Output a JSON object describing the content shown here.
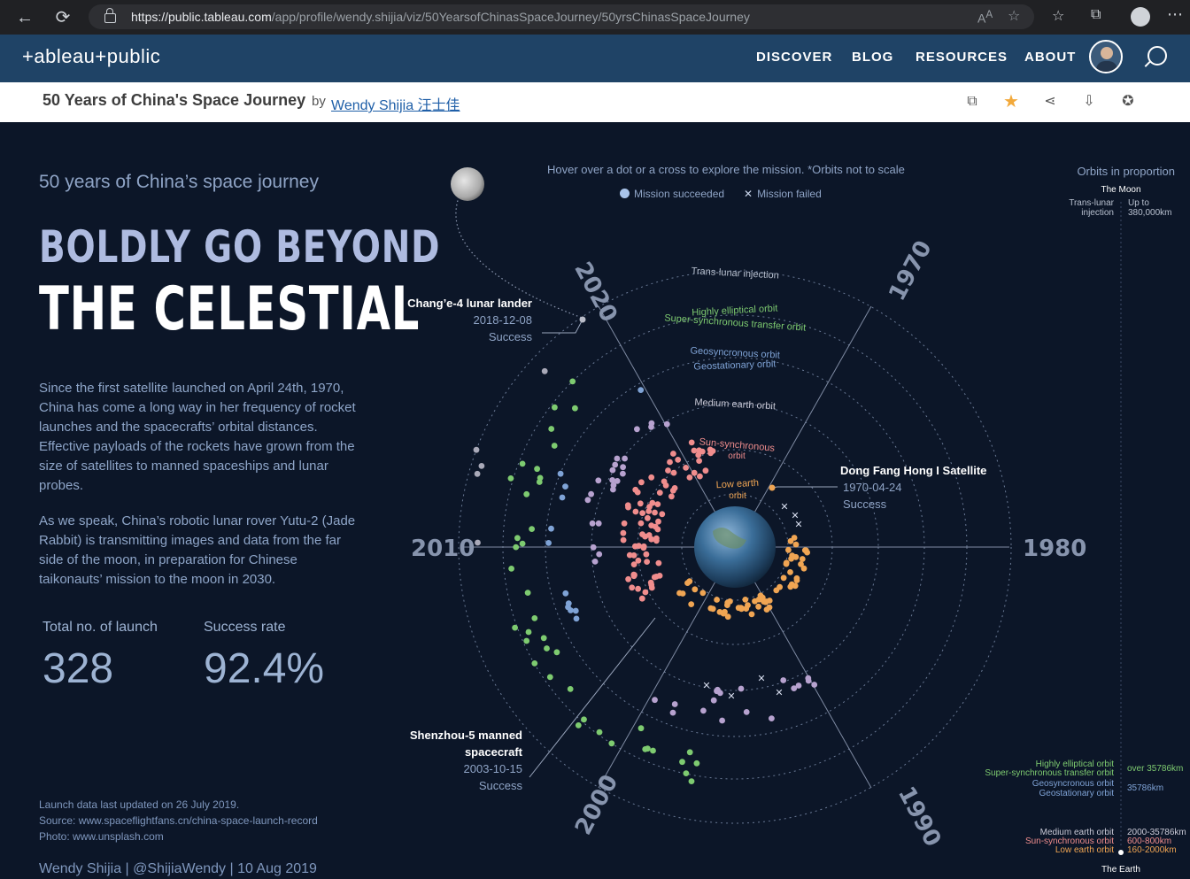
{
  "browser": {
    "url_domain": "https://public.tableau.com",
    "url_path": "/app/profile/wendy.shijia/viz/50YearsofChinasSpaceJourney/50yrsChinasSpaceJourney"
  },
  "header": {
    "logo": "+ableau+public",
    "nav": [
      "DISCOVER",
      "BLOG",
      "RESOURCES",
      "ABOUT"
    ]
  },
  "titlebar": {
    "title": "50 Years of China's Space Journey",
    "by": "by",
    "author": "Wendy Shijia 汪士佳"
  },
  "left": {
    "subtitle": "50 years of China’s space journey",
    "headline1": "BOLDLY GO BEYOND",
    "headline2": "THE CELESTIAL",
    "para1": "Since the first satellite launched on April 24th, 1970, China has come a long way in her frequency of rocket launches and the spacecrafts’ orbital distances. Effective payloads of the rockets have grown from the size of satellites to manned spaceships and lunar probes.",
    "para2": "As we speak, China’s robotic lunar rover Yutu-2 (Jade Rabbit) is transmitting images and data from the far side of the moon, in preparation for Chinese taikonauts’ mission to the moon in 2030.",
    "kpi_launch_label": "Total no. of launch",
    "kpi_launch_value": "328",
    "kpi_rate_label": "Success rate",
    "kpi_rate_value": "92.4%",
    "updated": "Launch data last updated on 26 July 2019.",
    "source": "Source:  www.spaceflightfans.cn/china-space-launch-record",
    "photo": "Photo: www.unsplash.com",
    "byline": "Wendy Shijia  | @ShijiaWendy | 10 Aug 2019"
  },
  "viz": {
    "hover_hint": "Hover over a dot or a cross to explore the mission. *Orbits not to scale",
    "legend_success": "Mission succeeded",
    "legend_failed": "Mission failed",
    "years": [
      "2020",
      "1970",
      "2010",
      "1980",
      "2000",
      "1990"
    ],
    "orbits": [
      "Trans-lunar injection",
      "Highly elliptical orbit",
      "Super-synchronous transfer orbit",
      "Geosyncronous orbit",
      "Geostationary orbit",
      "Medium earth orbit",
      "Sun-synchronous",
      "orbit",
      "Low earth",
      "orbit"
    ],
    "callouts": [
      {
        "title": "Chang’e-4  lunar lander",
        "date": "2018-12-08",
        "status": "Success"
      },
      {
        "title": "Dong Fang Hong I Satellite",
        "date": "1970-04-24",
        "status": "Success"
      },
      {
        "title": "Shenzhou-5 manned",
        "title2": "spacecraft",
        "date": "2003-10-15",
        "status": "Success"
      }
    ]
  },
  "proportion": {
    "title": "Orbits in proportion",
    "moon": "The Moon",
    "tli": "Trans-lunar",
    "tli2": "injection",
    "tli_dist": "Up to",
    "tli_dist2": "380,000km",
    "heo": "Highly elliptical orbit",
    "heo_dist": "over 35786km",
    "sto": "Super-synchronous transfer orbit",
    "geo": "Geosyncronous orbit",
    "geo2": "Geostationary orbit",
    "geo_dist": "35786km",
    "meo": "Medium earth orbit",
    "meo_dist": "2000-35786km",
    "sso": "Sun-synchronous orbit",
    "sso_dist": "600-800km",
    "leo": "Low earth orbit",
    "leo_dist": "160-2000km",
    "earth": "The Earth"
  },
  "colors": {
    "leo": "#f0a553",
    "sso": "#f08d8d",
    "meo": "#b7a2cf",
    "geo": "#7fa3d6",
    "heo": "#7ecb70",
    "tli": "#a9a9b8"
  }
}
